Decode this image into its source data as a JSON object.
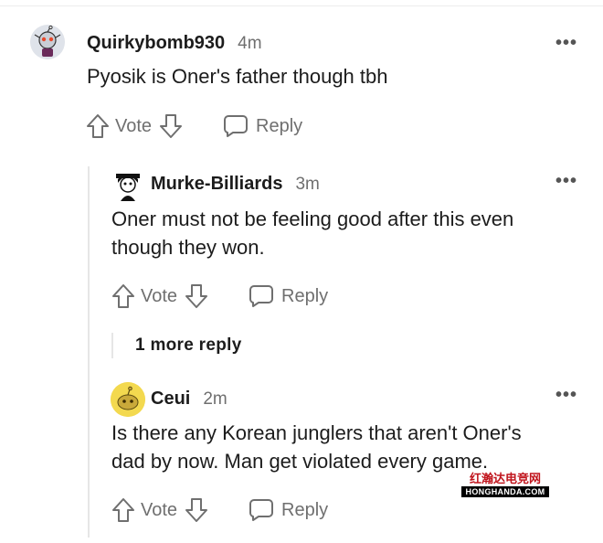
{
  "comments": [
    {
      "username": "Quirkybomb930",
      "time": "4m",
      "lines": [
        "Pyosik is Oner's father though tbh"
      ],
      "vote_label": "Vote",
      "reply_label": "Reply",
      "more_label": "•••"
    },
    {
      "username": "Murke-Billiards",
      "time": "3m",
      "lines": [
        "Oner must not be feeling good after this even",
        "though they won."
      ],
      "vote_label": "Vote",
      "reply_label": "Reply",
      "more_label": "•••"
    },
    {
      "username": "Ceui",
      "time": "2m",
      "lines": [
        "Is there any Korean junglers that aren't Oner's",
        "dad by now. Man get violated every game."
      ],
      "vote_label": "Vote",
      "reply_label": "Reply",
      "more_label": "•••"
    }
  ],
  "more_replies_label": "1 more reply",
  "watermark": {
    "cn": "红瀚达电竞网",
    "en": "HONGHANDA.COM"
  },
  "colors": {
    "text": "#1c1c1c",
    "muted": "#6f6f6f",
    "thread_line": "#e6e6e6",
    "watermark_red": "#c0141c"
  }
}
